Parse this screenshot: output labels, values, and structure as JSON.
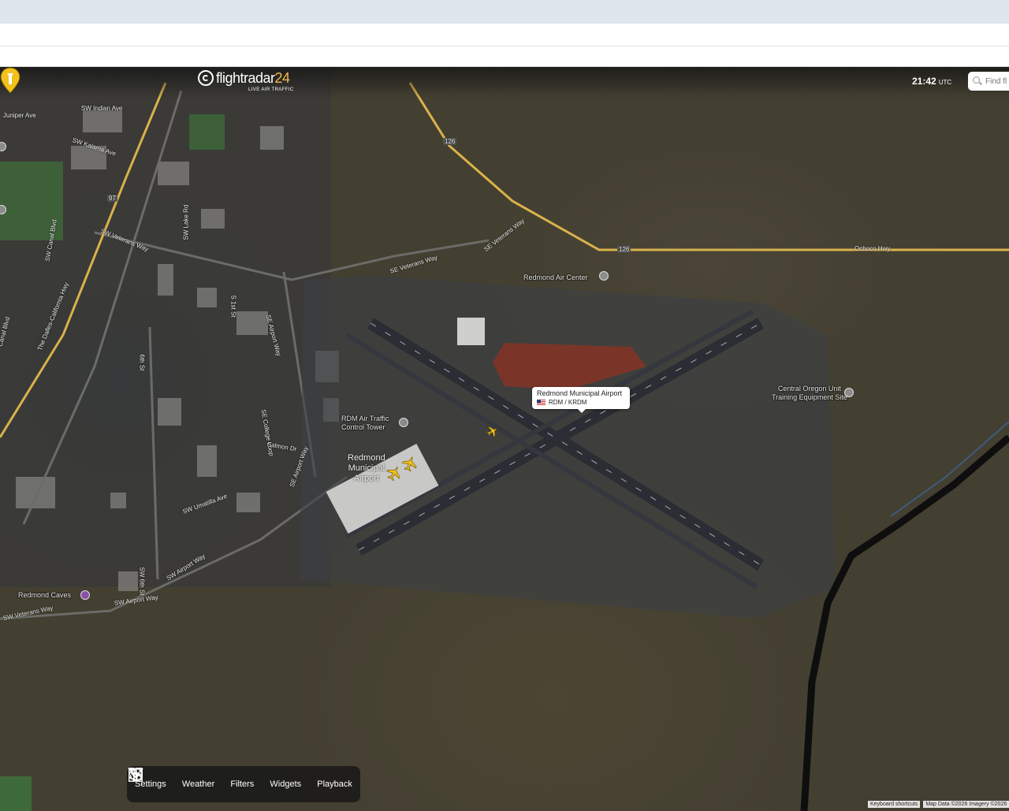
{
  "app": {
    "logo_main": "flightradar",
    "logo_num": "24",
    "logo_sub": "LIVE AIR TRAFFIC",
    "clock_time": "21:42",
    "clock_zone": "UTC",
    "search_placeholder": "Find fl"
  },
  "airport": {
    "name": "Redmond Municipal Airport",
    "code": "RDM / KRDM",
    "map_label_line1": "Redmond",
    "map_label_line2": "Municipal",
    "map_label_line3": "Airport"
  },
  "places": {
    "air_center": "Redmond Air Center",
    "tower_line1": "RDM Air Traffic",
    "tower_line2": "Control Tower",
    "training_line1": "Central Oregon Unit",
    "training_line2": "Training Equipment Site",
    "caves": "Redmond Caves"
  },
  "roads": {
    "se_veterans_way": "SE Veterans Way",
    "se_veterans_way_2": "SE Veterans Way",
    "sw_veterans_way": "SW Veterans Way",
    "ochoco": "Ochoco Hwy",
    "hwy126": "126",
    "hwy126b": "126",
    "hwy97": "97",
    "sw_indian": "SW Indian Ave",
    "juniper": "Juniper Ave",
    "kalama": "SW Kalama Ave",
    "canal": "SW Canal Blvd",
    "canal_left": "Canal Blvd",
    "dalles": "The Dalles-California Hwy",
    "lake": "SW Lake Rd",
    "se_airport_way": "SE Airport Way",
    "se_airport_way_2": "SE Airport Way",
    "sw_airport_way": "SW Airport Way",
    "sw_airport_way_2": "SW Airport Way",
    "sixth": "6th St",
    "sw_6th": "SW 6th St",
    "st_1": "S 1st St",
    "college": "SE College Loop",
    "salmon": "Salmon Dr",
    "umatilla": "SW Umatilla Ave",
    "sw_veterans": "SW Veterans Way"
  },
  "toolbar": {
    "settings": "Settings",
    "weather": "Weather",
    "filters": "Filters",
    "widgets": "Widgets",
    "playback": "Playback"
  },
  "footer": {
    "shortcuts": "Keyboard shortcuts",
    "map_data": "Map Data ©2026 Imagery ©2026"
  },
  "colors": {
    "accent": "#f5b94b",
    "aircraft": "#f2c11a",
    "highway": "#d9b24a"
  }
}
